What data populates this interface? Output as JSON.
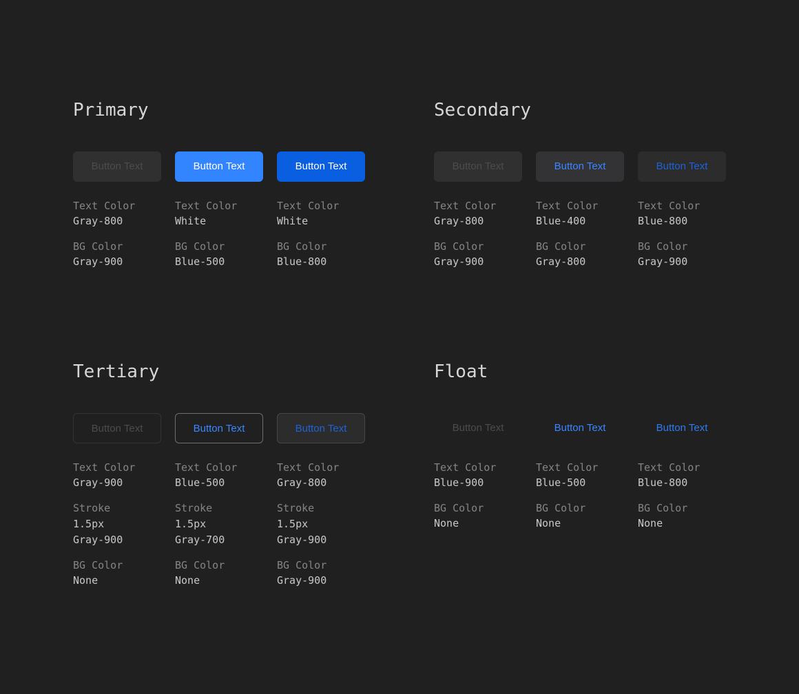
{
  "colors": {
    "page_bg": "#202020",
    "title": "#d6d6d6",
    "spec_label": "#858585",
    "spec_value": "#c8c8c8",
    "gray_900_bg": "#303030",
    "gray_800_bg": "#333335",
    "blue_500": "#3284ff",
    "blue_800": "#0a5ee0",
    "blue_400_text": "#3a86ff",
    "blue_text": "#2e7bf0"
  },
  "sections": {
    "primary": {
      "title": "Primary",
      "buttons": [
        {
          "label": "Button Text",
          "specs": [
            {
              "label": "Text Color",
              "value": "Gray-800"
            },
            {
              "label": "BG Color",
              "value": "Gray-900"
            }
          ]
        },
        {
          "label": "Button Text",
          "specs": [
            {
              "label": "Text Color",
              "value": "White"
            },
            {
              "label": "BG Color",
              "value": "Blue-500"
            }
          ]
        },
        {
          "label": "Button Text",
          "specs": [
            {
              "label": "Text Color",
              "value": "White"
            },
            {
              "label": "BG Color",
              "value": "Blue-800"
            }
          ]
        }
      ]
    },
    "secondary": {
      "title": "Secondary",
      "buttons": [
        {
          "label": "Button Text",
          "specs": [
            {
              "label": "Text Color",
              "value": "Gray-800"
            },
            {
              "label": "BG Color",
              "value": "Gray-900"
            }
          ]
        },
        {
          "label": "Button Text",
          "specs": [
            {
              "label": "Text Color",
              "value": "Blue-400"
            },
            {
              "label": "BG Color",
              "value": "Gray-800"
            }
          ]
        },
        {
          "label": "Button Text",
          "specs": [
            {
              "label": "Text Color",
              "value": "Blue-800"
            },
            {
              "label": "BG Color",
              "value": "Gray-900"
            }
          ]
        }
      ]
    },
    "tertiary": {
      "title": "Tertiary",
      "buttons": [
        {
          "label": "Button Text",
          "specs": [
            {
              "label": "Text Color",
              "value": "Gray-900"
            },
            {
              "label": "Stroke",
              "value": "1.5px",
              "value2": "Gray-900"
            },
            {
              "label": "BG Color",
              "value": "None"
            }
          ]
        },
        {
          "label": "Button Text",
          "specs": [
            {
              "label": "Text Color",
              "value": "Blue-500"
            },
            {
              "label": "Stroke",
              "value": "1.5px",
              "value2": "Gray-700"
            },
            {
              "label": "BG Color",
              "value": "None"
            }
          ]
        },
        {
          "label": "Button Text",
          "specs": [
            {
              "label": "Text Color",
              "value": "Gray-800"
            },
            {
              "label": "Stroke",
              "value": "1.5px",
              "value2": "Gray-900"
            },
            {
              "label": "BG Color",
              "value": "Gray-900"
            }
          ]
        }
      ]
    },
    "float": {
      "title": "Float",
      "buttons": [
        {
          "label": "Button Text",
          "specs": [
            {
              "label": "Text Color",
              "value": "Blue-900"
            },
            {
              "label": "BG Color",
              "value": "None"
            }
          ]
        },
        {
          "label": "Button Text",
          "specs": [
            {
              "label": "Text Color",
              "value": "Blue-500"
            },
            {
              "label": "BG Color",
              "value": "None"
            }
          ]
        },
        {
          "label": "Button Text",
          "specs": [
            {
              "label": "Text Color",
              "value": "Blue-800"
            },
            {
              "label": "BG Color",
              "value": "None"
            }
          ]
        }
      ]
    }
  }
}
